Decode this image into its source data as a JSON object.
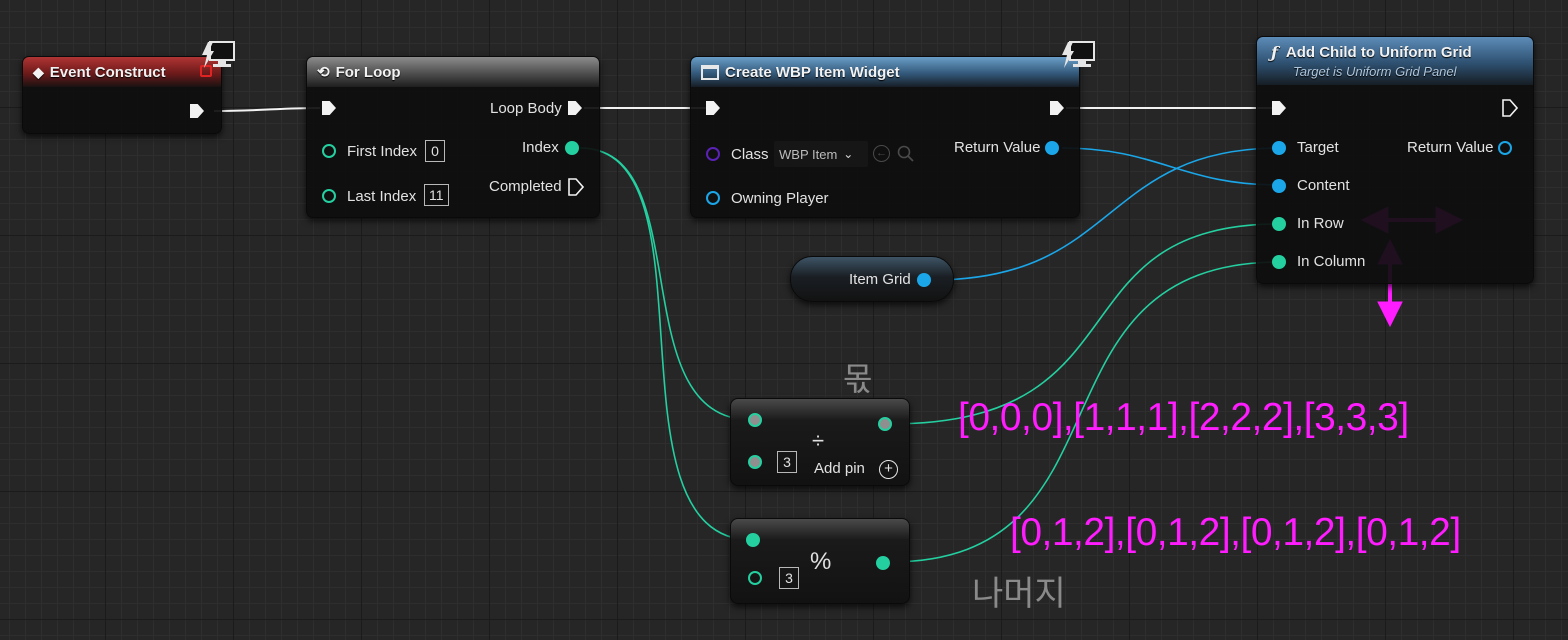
{
  "colors": {
    "exec": "#f2f2f2",
    "int_pin": "#24cfa0",
    "object_pin": "#1aa6e8",
    "class_pin": "#5a22b6",
    "annotation": "#ff1cff",
    "event_header": "#b03434",
    "macro_header": "#8c8c8c",
    "function_header": "#5c8cb8"
  },
  "event_construct": {
    "title": "Event Construct",
    "icon": "event-diamond-icon"
  },
  "for_loop": {
    "title": "For Loop",
    "icon": "loop-icon",
    "loop_body_label": "Loop Body",
    "first_index_label": "First Index",
    "first_index_value": "0",
    "index_label": "Index",
    "last_index_label": "Last Index",
    "last_index_value": "11",
    "completed_label": "Completed"
  },
  "create_widget": {
    "title": "Create WBP Item Widget",
    "icon": "widget-icon",
    "class_label": "Class",
    "class_value": "WBP Item",
    "return_value_label": "Return Value",
    "owning_player_label": "Owning Player"
  },
  "add_child": {
    "title": "Add Child to Uniform Grid",
    "subtitle": "Target is Uniform Grid Panel",
    "icon": "function-icon",
    "target_label": "Target",
    "return_value_label": "Return Value",
    "content_label": "Content",
    "in_row_label": "In Row",
    "in_column_label": "In Column"
  },
  "item_grid": {
    "label": "Item Grid"
  },
  "divide_node": {
    "symbol": "÷",
    "divisor_value": "3",
    "add_pin_label": "Add pin"
  },
  "modulo_node": {
    "symbol": "%",
    "divisor_value": "3"
  },
  "annotations": {
    "quotient_korean": "몫",
    "remainder_korean": "나머지",
    "row_sequence": "[0,0,0],[1,1,1],[2,2,2],[3,3,3]",
    "column_sequence": "[0,1,2],[0,1,2],[0,1,2],[0,1,2]"
  }
}
